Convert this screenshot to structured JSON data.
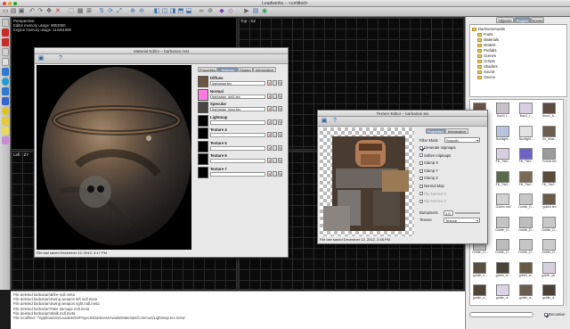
{
  "app": {
    "title": "Leadwerks – <untitled>"
  },
  "viewports": {
    "perspective": {
      "label": "Perspective",
      "editor_mem": "Editor memory usage: 9952050",
      "engine_mem": "Engine memory usage: 112461988"
    },
    "top": {
      "label": "Top - XZ"
    },
    "left": {
      "label": "Left - ZY"
    },
    "front": {
      "label": "Front - XY"
    }
  },
  "console": {
    "lines": [
      "File deleted barbarian\\Bfire-mdl.meta",
      "File deleted barbarian\\Swing weapon left.mdl.meta",
      "File deleted barbarian\\Swing weapon right.mdl.meta",
      "File deleted barbarian\\Take damage.mdl.meta",
      "File deleted barbarian\\Walk.mdl.meta",
      "File modified: \"/Applications/Leadwerks/Projects/DarknessAwaits/Materials/Common/Lightmap.tex.meta\""
    ]
  },
  "right_panel": {
    "tabs": [
      "Objects",
      "Project",
      "Scene"
    ],
    "selected_tab": "Project",
    "tree": {
      "root": "DarknessAwaits",
      "folders": [
        "Fonts",
        "Materials",
        "Models",
        "Prefabs",
        "Scenes",
        "Scripts",
        "Shaders",
        "Sound",
        "Source"
      ]
    },
    "thumbnails": [
      {
        "label": "barbarian..."
      },
      {
        "label": "floor1.t..."
      },
      {
        "label": "floor1_r..."
      },
      {
        "label": "floor1_b..."
      },
      {
        "label": "floor1 fa..."
      },
      {
        "label": "floorlight..."
      },
      {
        "label": "floorlight..."
      },
      {
        "label": "fin_ritua..."
      },
      {
        "label": "Fill_Tile2..."
      },
      {
        "label": "Fill_Tile2..."
      },
      {
        "label": "Fill_Tile2..."
      },
      {
        "label": "Foliole.tex"
      },
      {
        "label": "Fill_Tile2..."
      },
      {
        "label": "Fill_Tile2..."
      },
      {
        "label": "Fill_Tile2..."
      },
      {
        "label": "Fill_Tile2..."
      },
      {
        "label": "goblin.mdl"
      },
      {
        "label": "Goblin.mdl"
      },
      {
        "label": "Goblin_D..."
      },
      {
        "label": "goblin.tex"
      },
      {
        "label": "Goblin_D..."
      },
      {
        "label": "Goblin_D..."
      },
      {
        "label": "Goblin_D..."
      },
      {
        "label": "Goblin_D..."
      },
      {
        "label": "Goblin_D..."
      },
      {
        "label": "Goblin_D..."
      },
      {
        "label": "Goblin_D..."
      },
      {
        "label": "Goblin_D..."
      },
      {
        "label": "goblin_s..."
      },
      {
        "label": "goblin_sl..."
      },
      {
        "label": "goblin_sl..."
      },
      {
        "label": "goblin_sk..."
      },
      {
        "label": "goblin_d..."
      },
      {
        "label": "goblin_d..."
      },
      {
        "label": "goblin_d..."
      },
      {
        "label": "goblin_d..."
      }
    ],
    "recursive_label": "Recursive",
    "recursive_checked": true
  },
  "material_editor": {
    "title": "Material Editor – barbarian.mat",
    "tabs": [
      "Properties",
      "Textures",
      "Shader",
      "Information"
    ],
    "selected_tab": "Textures",
    "slots": [
      {
        "name": "Diffuse",
        "file": "barbarian.tex",
        "swatch": "#6b5540"
      },
      {
        "name": "Normal",
        "file": "barbarian_dot3.tex",
        "swatch": "#ff7be0"
      },
      {
        "name": "Specular",
        "file": "barbarian_spec.tex",
        "swatch": "#4a4642"
      },
      {
        "name": "Lightmap",
        "file": "",
        "swatch": "#000000"
      },
      {
        "name": "Texture 4",
        "file": "",
        "swatch": "#000000"
      },
      {
        "name": "Texture 5",
        "file": "",
        "swatch": "#000000"
      },
      {
        "name": "Texture 6",
        "file": "",
        "swatch": "#000000"
      },
      {
        "name": "Texture 7",
        "file": "",
        "swatch": "#000000"
      }
    ],
    "status": "File last saved December 12, 2012, 3:17 PM"
  },
  "texture_editor": {
    "title": "Texture Editor – barbarian.tex",
    "tabs": [
      "Properties",
      "Information"
    ],
    "selected_tab": "Properties",
    "filter_mode_label": "Filter Mode",
    "filter_mode_value": "Smooth",
    "options": [
      {
        "label": "Generate mipmaps",
        "checked": true,
        "enabled": true
      },
      {
        "label": "Soften mipmaps",
        "checked": false,
        "enabled": true
      },
      {
        "label": "Clamp X",
        "checked": false,
        "enabled": true
      },
      {
        "label": "Clamp Y",
        "checked": false,
        "enabled": true
      },
      {
        "label": "Clamp Z",
        "checked": false,
        "enabled": true
      },
      {
        "label": "Normal Map",
        "checked": false,
        "enabled": true
      },
      {
        "label": "Flip Normal X",
        "checked": false,
        "enabled": false
      },
      {
        "label": "Flip Normal Y",
        "checked": false,
        "enabled": false
      }
    ],
    "bumpiness_label": "Bumpiness",
    "bumpiness_value": "1.0",
    "texture_label": "Texture",
    "texture_value": "Texture",
    "status": "File last saved December 12, 2012, 2:48 PM"
  },
  "colors": {
    "tab_selected": "#7f93ad",
    "normal_swatch": "#ff7be0",
    "folder": "#e6c25a"
  }
}
